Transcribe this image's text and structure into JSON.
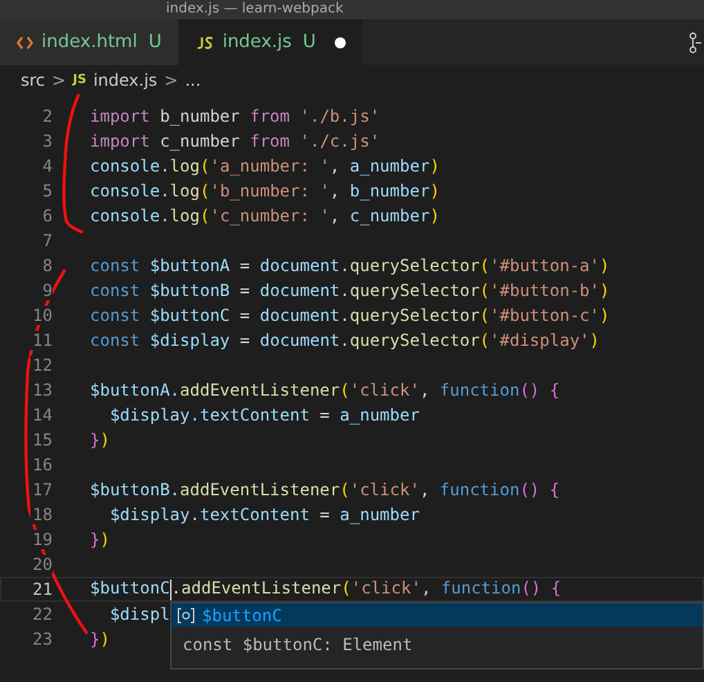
{
  "window": {
    "title": "index.js — learn-webpack"
  },
  "tabs": [
    {
      "kind": "html",
      "label": "index.html",
      "status": "U",
      "modified": false,
      "selected": false
    },
    {
      "kind": "js",
      "label": "index.js",
      "status": "U",
      "modified": true,
      "selected": true
    }
  ],
  "breadcrumb": {
    "folder": "src",
    "sep1": ">",
    "icon_text": "JS",
    "file": "index.js",
    "sep2": ">",
    "more": "..."
  },
  "editor": {
    "lines": [
      {
        "number": "2",
        "current": false,
        "tokens": [
          {
            "kind": "kw",
            "t": "import"
          },
          {
            "kind": "p",
            "t": " b_number "
          },
          {
            "kind": "kw",
            "t": "from"
          },
          {
            "kind": "str",
            "t": " './b.js'"
          }
        ]
      },
      {
        "number": "3",
        "current": false,
        "tokens": [
          {
            "kind": "kw",
            "t": "import"
          },
          {
            "kind": "p",
            "t": " c_number "
          },
          {
            "kind": "kw",
            "t": "from"
          },
          {
            "kind": "str",
            "t": " './c.js'"
          }
        ]
      },
      {
        "number": "4",
        "current": false,
        "tokens": [
          {
            "kind": "var",
            "t": "console."
          },
          {
            "kind": "fn",
            "t": "log"
          },
          {
            "kind": "b1",
            "t": "("
          },
          {
            "kind": "str",
            "t": "'a_number: '"
          },
          {
            "kind": "p",
            "t": ","
          },
          {
            "kind": "var",
            "t": " a_number"
          },
          {
            "kind": "b1",
            "t": ")"
          }
        ]
      },
      {
        "number": "5",
        "current": false,
        "tokens": [
          {
            "kind": "var",
            "t": "console."
          },
          {
            "kind": "fn",
            "t": "log"
          },
          {
            "kind": "b1",
            "t": "("
          },
          {
            "kind": "str",
            "t": "'b_number: '"
          },
          {
            "kind": "p",
            "t": ","
          },
          {
            "kind": "var",
            "t": " b_number"
          },
          {
            "kind": "b1",
            "t": ")"
          }
        ]
      },
      {
        "number": "6",
        "current": false,
        "tokens": [
          {
            "kind": "var",
            "t": "console."
          },
          {
            "kind": "fn",
            "t": "log"
          },
          {
            "kind": "b1",
            "t": "("
          },
          {
            "kind": "str",
            "t": "'c_number: '"
          },
          {
            "kind": "p",
            "t": ","
          },
          {
            "kind": "var",
            "t": " c_number"
          },
          {
            "kind": "b1",
            "t": ")"
          }
        ]
      },
      {
        "number": "7",
        "current": false
      },
      {
        "number": "8",
        "current": false,
        "tokens": [
          {
            "kind": "dec",
            "t": "const"
          },
          {
            "kind": "var",
            "t": " $buttonA"
          },
          {
            "kind": "p",
            "t": " = "
          },
          {
            "kind": "var",
            "t": "document."
          },
          {
            "kind": "fn",
            "t": "querySelector"
          },
          {
            "kind": "b1",
            "t": "("
          },
          {
            "kind": "str",
            "t": "'#button-a'"
          },
          {
            "kind": "b1",
            "t": ")"
          }
        ]
      },
      {
        "number": "9",
        "current": false,
        "tokens": [
          {
            "kind": "dec",
            "t": "const"
          },
          {
            "kind": "var",
            "t": " $buttonB"
          },
          {
            "kind": "p",
            "t": " = "
          },
          {
            "kind": "var",
            "t": "document."
          },
          {
            "kind": "fn",
            "t": "querySelector"
          },
          {
            "kind": "b1",
            "t": "("
          },
          {
            "kind": "str",
            "t": "'#button-b'"
          },
          {
            "kind": "b1",
            "t": ")"
          }
        ]
      },
      {
        "number": "10",
        "current": false,
        "tokens": [
          {
            "kind": "dec",
            "t": "const"
          },
          {
            "kind": "var",
            "t": " $buttonC"
          },
          {
            "kind": "p",
            "t": " = "
          },
          {
            "kind": "var",
            "t": "document."
          },
          {
            "kind": "fn",
            "t": "querySelector"
          },
          {
            "kind": "b1",
            "t": "("
          },
          {
            "kind": "str",
            "t": "'#button-c'"
          },
          {
            "kind": "b1",
            "t": ")"
          }
        ]
      },
      {
        "number": "11",
        "current": false,
        "tokens": [
          {
            "kind": "dec",
            "t": "const"
          },
          {
            "kind": "var",
            "t": " $display"
          },
          {
            "kind": "p",
            "t": " = "
          },
          {
            "kind": "var",
            "t": "document."
          },
          {
            "kind": "fn",
            "t": "querySelector"
          },
          {
            "kind": "b1",
            "t": "("
          },
          {
            "kind": "str",
            "t": "'#display'"
          },
          {
            "kind": "b1",
            "t": ")"
          }
        ]
      },
      {
        "number": "12",
        "current": false
      },
      {
        "number": "13",
        "current": false,
        "tokens": [
          {
            "kind": "var",
            "t": "$buttonA."
          },
          {
            "kind": "fn",
            "t": "addEventListener"
          },
          {
            "kind": "b1",
            "t": "("
          },
          {
            "kind": "str",
            "t": "'click'"
          },
          {
            "kind": "p",
            "t": ","
          },
          {
            "kind": "dec",
            "t": " function"
          },
          {
            "kind": "b2",
            "t": "() {"
          }
        ]
      },
      {
        "number": "14",
        "current": false,
        "tokens": [
          {
            "kind": "var",
            "t": "  $display.textContent"
          },
          {
            "kind": "p",
            "t": " = "
          },
          {
            "kind": "var",
            "t": "a_number"
          }
        ]
      },
      {
        "number": "15",
        "current": false,
        "tokens": [
          {
            "kind": "b2",
            "t": "}"
          },
          {
            "kind": "b1",
            "t": ")"
          }
        ]
      },
      {
        "number": "16",
        "current": false
      },
      {
        "number": "17",
        "current": false,
        "tokens": [
          {
            "kind": "var",
            "t": "$buttonB."
          },
          {
            "kind": "fn",
            "t": "addEventListener"
          },
          {
            "kind": "b1",
            "t": "("
          },
          {
            "kind": "str",
            "t": "'click'"
          },
          {
            "kind": "p",
            "t": ","
          },
          {
            "kind": "dec",
            "t": " function"
          },
          {
            "kind": "b2",
            "t": "() {"
          }
        ]
      },
      {
        "number": "18",
        "current": false,
        "tokens": [
          {
            "kind": "var",
            "t": "  $display.textContent"
          },
          {
            "kind": "p",
            "t": " = "
          },
          {
            "kind": "var",
            "t": "a_number"
          }
        ]
      },
      {
        "number": "19",
        "current": false,
        "tokens": [
          {
            "kind": "b2",
            "t": "}"
          },
          {
            "kind": "b1",
            "t": ")"
          }
        ]
      },
      {
        "number": "20",
        "current": false
      },
      {
        "number": "21",
        "current": true,
        "tokens": [
          {
            "kind": "var",
            "t": "$buttonC"
          },
          {
            "kind": "fn",
            "t": ".addEventListener"
          },
          {
            "kind": "b1",
            "t": "("
          },
          {
            "kind": "str",
            "t": "'click'"
          },
          {
            "kind": "p",
            "t": ","
          },
          {
            "kind": "dec",
            "t": " function"
          },
          {
            "kind": "b2",
            "t": "() {"
          }
        ]
      },
      {
        "number": "22",
        "current": false,
        "tokens": [
          {
            "kind": "var",
            "t": "  $displ"
          }
        ]
      },
      {
        "number": "23",
        "current": false,
        "tokens": [
          {
            "kind": "b2",
            "t": "}"
          },
          {
            "kind": "b1",
            "t": ")"
          }
        ]
      }
    ]
  },
  "suggest": {
    "items": [
      {
        "label": "$buttonC",
        "selected": true
      }
    ],
    "detail": "const $buttonC: Element"
  }
}
